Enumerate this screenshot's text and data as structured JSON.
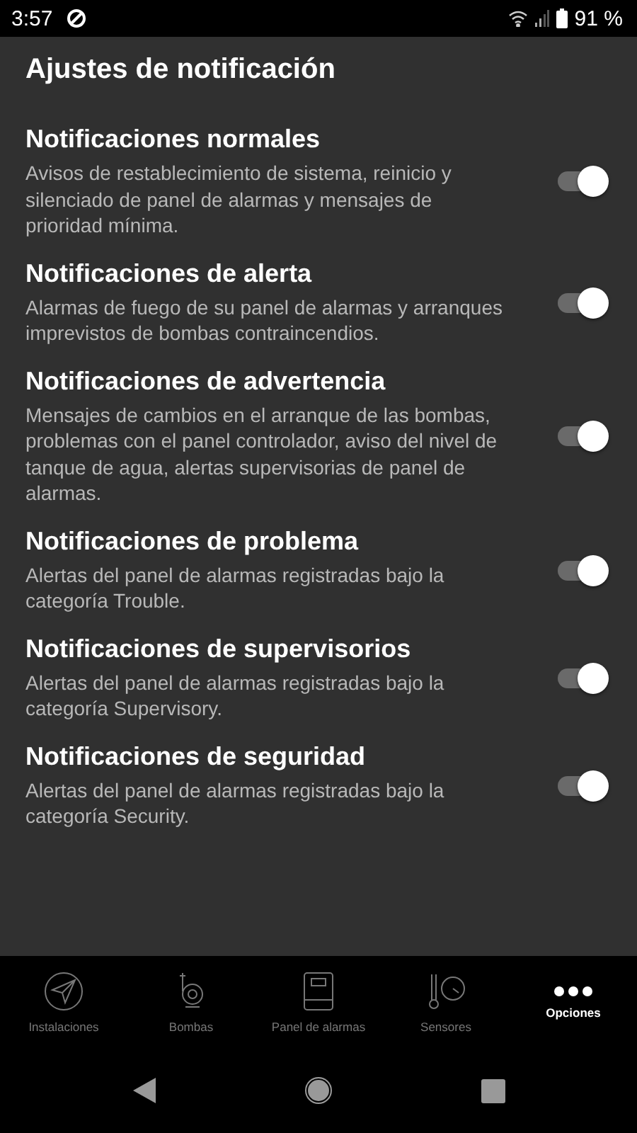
{
  "status_bar": {
    "time": "3:57",
    "battery": "91 %"
  },
  "title": "Ajustes de notificación",
  "settings": [
    {
      "title": "Notificaciones normales",
      "description": "Avisos de restablecimiento de sistema, reinicio y silenciado de panel de alarmas y mensajes de prioridad mínima.",
      "on": true
    },
    {
      "title": "Notificaciones de alerta",
      "description": "Alarmas de fuego de su panel de alarmas y arranques imprevistos de bombas contraincendios.",
      "on": true
    },
    {
      "title": "Notificaciones de advertencia",
      "description": "Mensajes de cambios en el arranque de las bombas, problemas con el panel controlador, aviso del nivel de tanque de agua, alertas supervisorias de panel de alarmas.",
      "on": true
    },
    {
      "title": "Notificaciones de problema",
      "description": "Alertas del panel de alarmas registradas bajo la categoría Trouble.",
      "on": true
    },
    {
      "title": "Notificaciones de supervisorios",
      "description": "Alertas del panel de alarmas registradas bajo la categoría Supervisory.",
      "on": true
    },
    {
      "title": "Notificaciones de seguridad",
      "description": "Alertas del panel de alarmas registradas bajo la categoría Security.",
      "on": true
    }
  ],
  "nav": [
    {
      "kind": "plane",
      "label": "Instalaciones",
      "selected": false
    },
    {
      "kind": "pump",
      "label": "Bombas",
      "selected": false
    },
    {
      "kind": "panel",
      "label": "Panel de alarmas",
      "selected": false
    },
    {
      "kind": "sensor",
      "label": "Sensores",
      "selected": false
    },
    {
      "kind": "dots",
      "label": "Opciones",
      "selected": true
    }
  ]
}
